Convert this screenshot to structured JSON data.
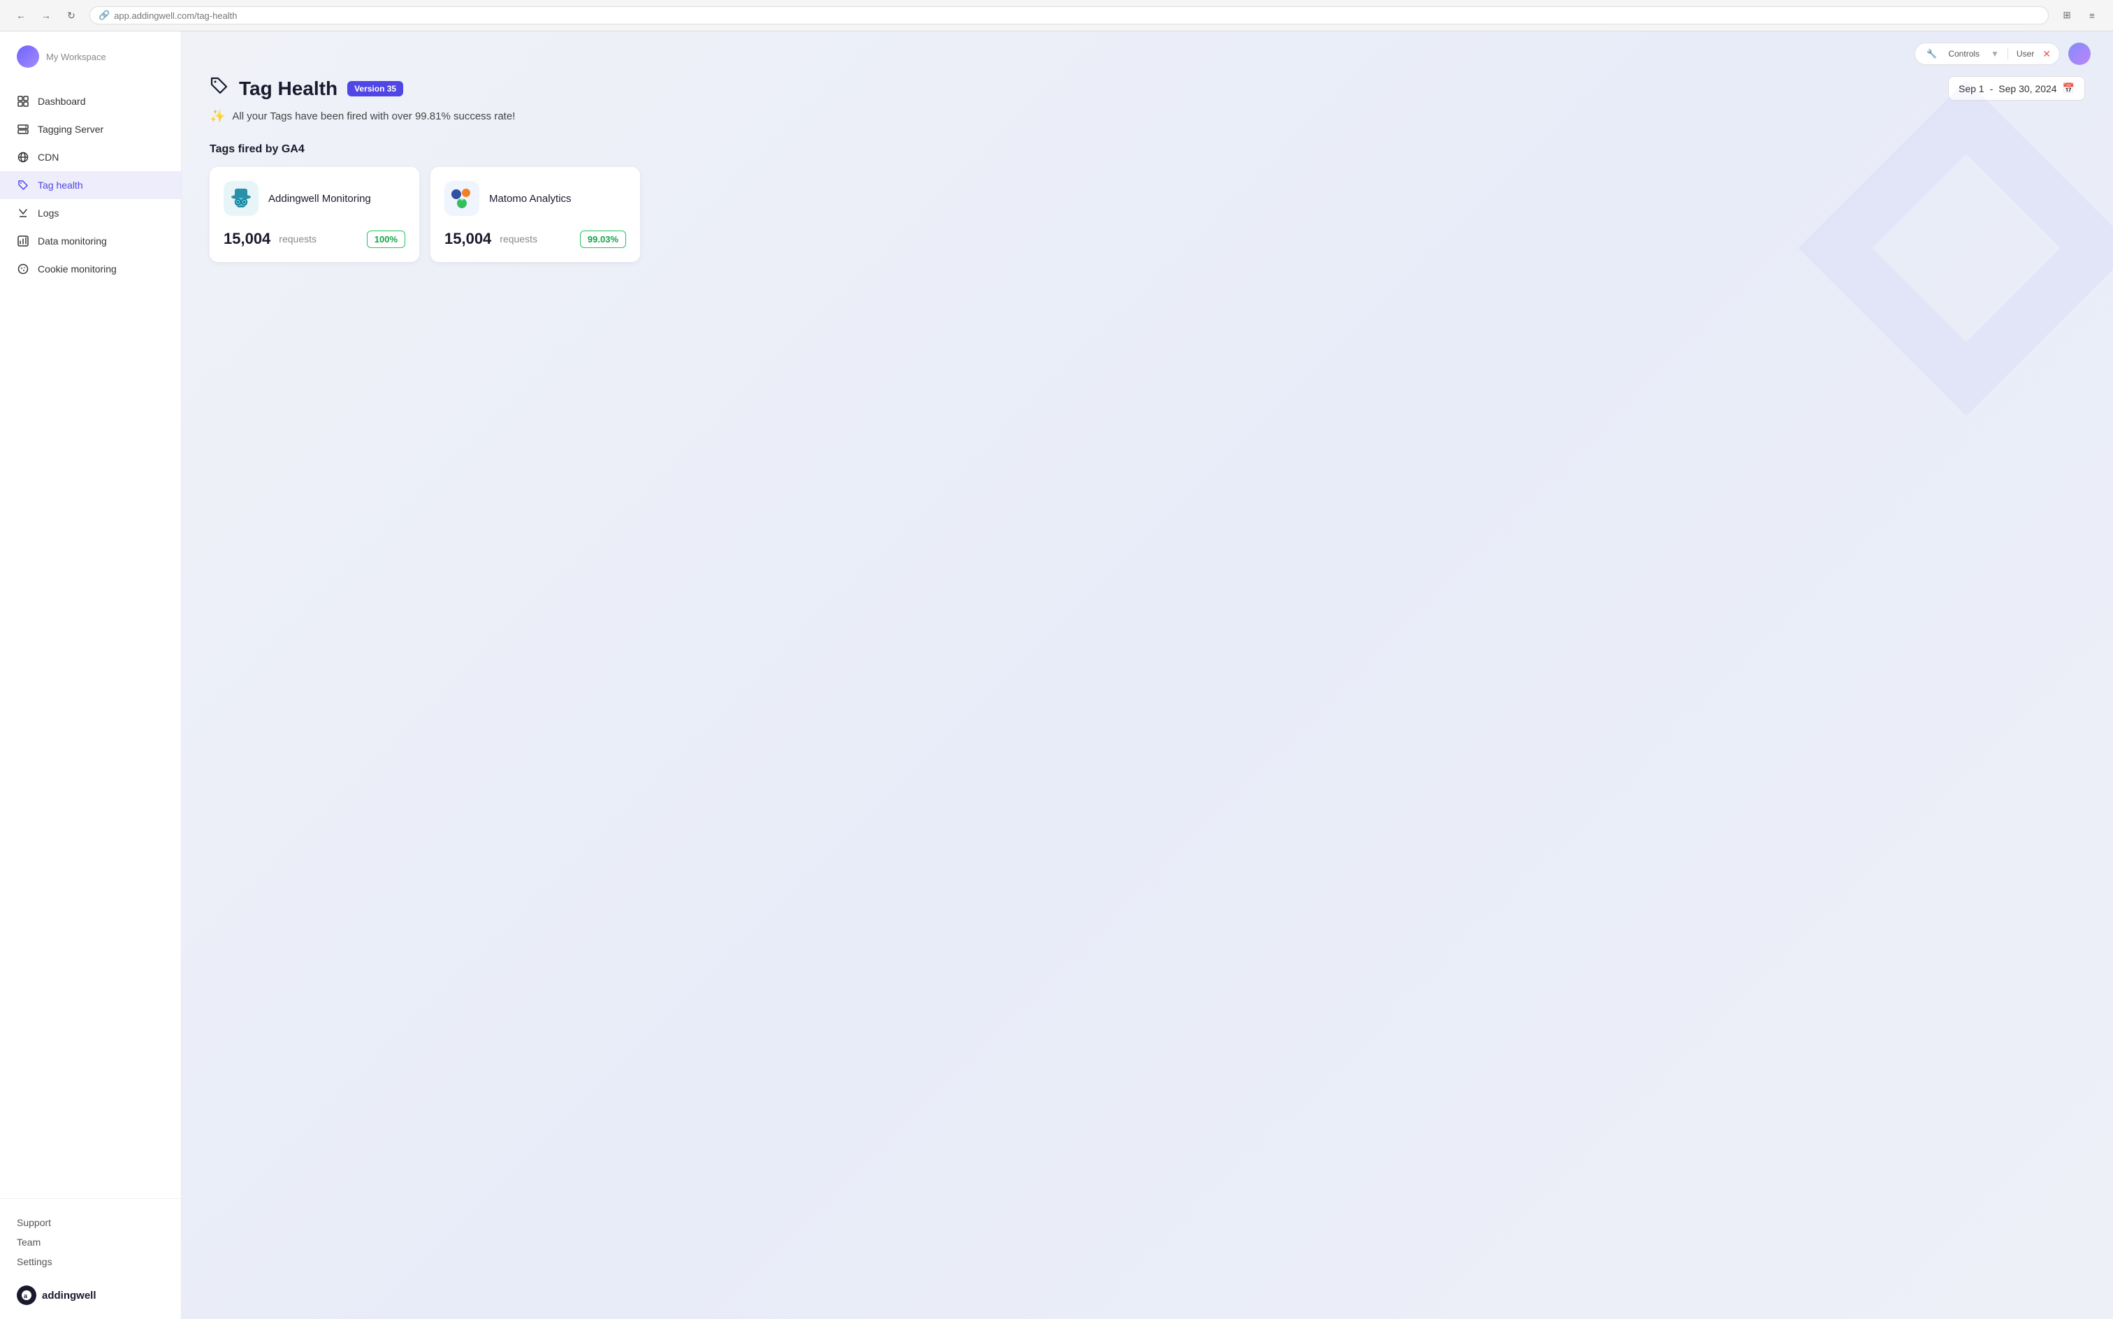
{
  "browser": {
    "address": "app.addingwell.com/tag-health",
    "link_icon": "🔗"
  },
  "sidebar": {
    "header": {
      "workspace": "My Workspace"
    },
    "nav_items": [
      {
        "id": "dashboard",
        "label": "Dashboard",
        "icon": "dashboard"
      },
      {
        "id": "tagging-server",
        "label": "Tagging Server",
        "icon": "server"
      },
      {
        "id": "cdn",
        "label": "CDN",
        "icon": "globe"
      },
      {
        "id": "tag-health",
        "label": "Tag health",
        "icon": "tag",
        "active": true
      },
      {
        "id": "logs",
        "label": "Logs",
        "icon": "logs"
      },
      {
        "id": "data-monitoring",
        "label": "Data monitoring",
        "icon": "data"
      },
      {
        "id": "cookie-monitoring",
        "label": "Cookie monitoring",
        "icon": "cookie"
      }
    ],
    "footer_links": [
      {
        "id": "support",
        "label": "Support"
      },
      {
        "id": "team",
        "label": "Team"
      },
      {
        "id": "settings",
        "label": "Settings"
      }
    ],
    "brand": {
      "name": "addingwell",
      "logo_letter": "a"
    }
  },
  "topbar": {
    "controls_label": "Controls",
    "close_icon": "✕"
  },
  "page": {
    "title": "Tag Health",
    "title_icon": "🏷",
    "version_badge": "Version 35",
    "date_range": {
      "start": "Sep 1",
      "separator": "-",
      "end": "Sep 30, 2024"
    },
    "success_message": "All your Tags have been fired with over 99.81% success rate!",
    "section_title": "Tags fired by GA4",
    "cards": [
      {
        "id": "addingwell-monitoring",
        "name": "Addingwell Monitoring",
        "requests": "15,004",
        "requests_label": "requests",
        "success_rate": "100%",
        "logo_type": "addingwell"
      },
      {
        "id": "matomo-analytics",
        "name": "Matomo Analytics",
        "requests": "15,004",
        "requests_label": "requests",
        "success_rate": "99.03%",
        "logo_type": "matomo"
      }
    ]
  }
}
